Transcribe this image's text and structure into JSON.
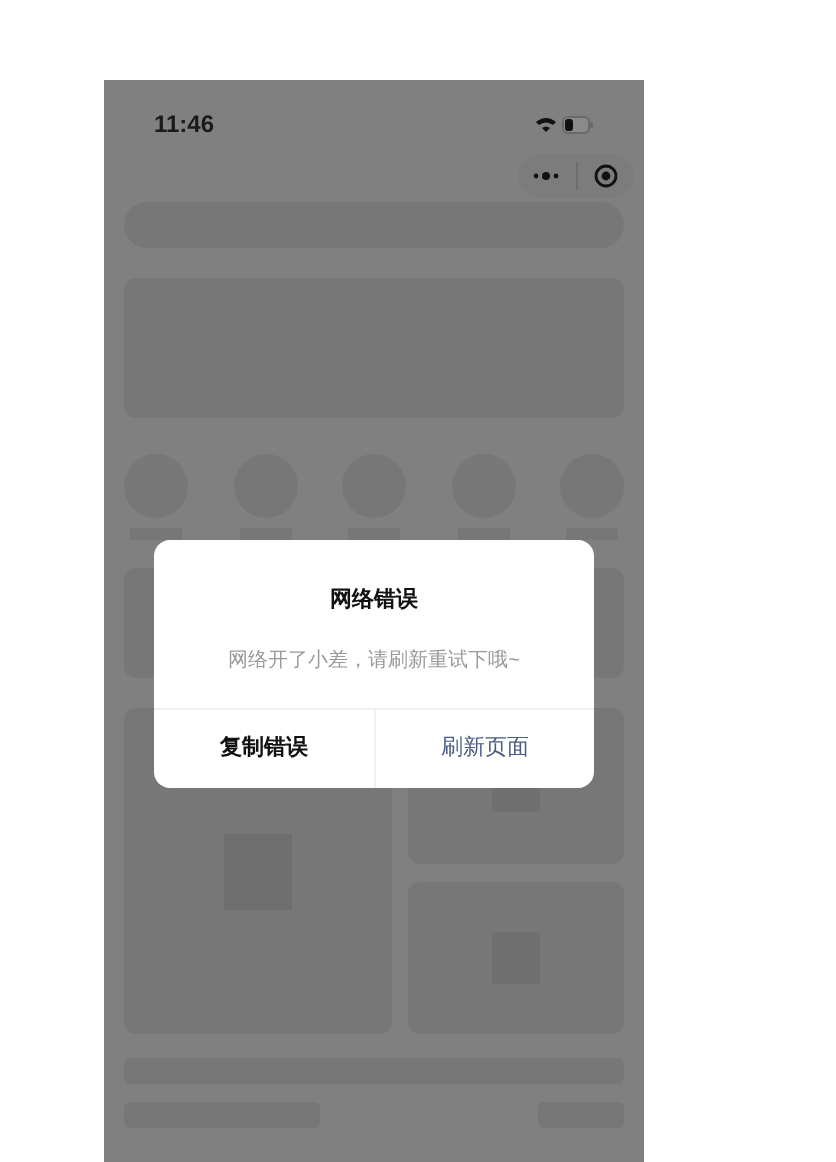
{
  "status_bar": {
    "time": "11:46"
  },
  "dialog": {
    "title": "网络错误",
    "message": "网络开了小差，请刷新重试下哦~",
    "buttons": [
      {
        "label": "复制错误",
        "kind": "secondary"
      },
      {
        "label": "刷新页面",
        "kind": "primary"
      }
    ]
  }
}
